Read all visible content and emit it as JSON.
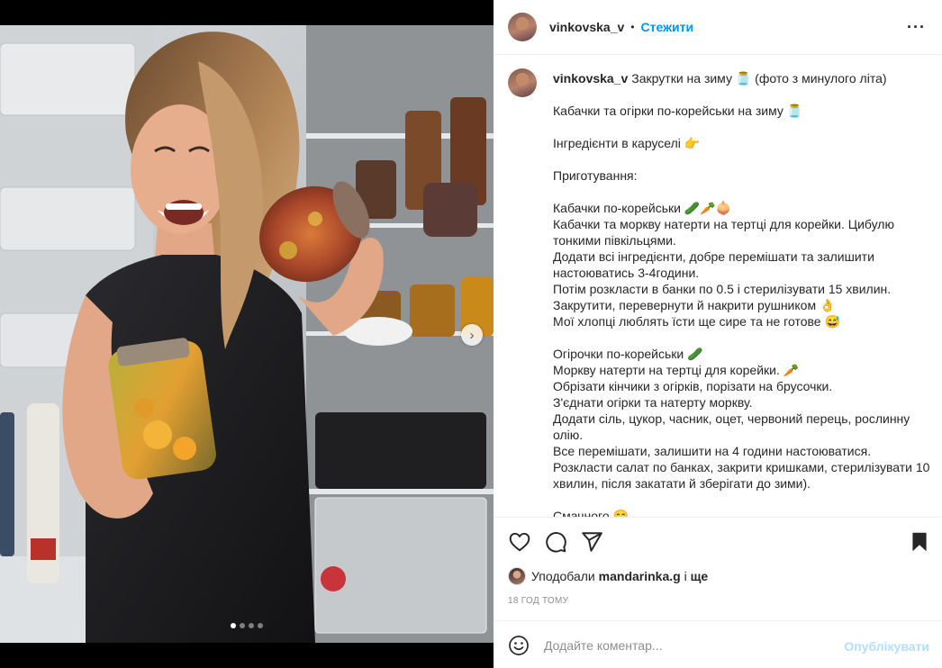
{
  "header": {
    "username": "vinkovska_v",
    "separator": "•",
    "follow_label": "Стежити",
    "more_label": "···"
  },
  "caption": {
    "username": "vinkovska_v",
    "first_line": "Закрутки на зиму 🫙 (фото з минулого літа)",
    "lines": [
      "",
      "Кабачки та огірки по-корейськи на зиму 🫙",
      "",
      "Інгредієнти в каруселі 👉",
      "",
      "Приготування:",
      "",
      "Кабачки по-корейськи 🥒🥕🧅",
      "Кабачки та моркву натерти на тертці для корейки. Цибулю тонкими півкільцями.",
      "Додати всі інгредієнти, добре перемішати та залишити настоюватись 3-4години.",
      "Потім розкласти в банки по 0.5 і стерилізувати 15 хвилин.",
      "Закрутити, перевернути й накрити рушником 👌",
      "Мої хлопці люблять їсти ще сире та не готове 😅",
      "",
      "Огірочки по-корейськи 🥒",
      "Моркву натерти на тертці для корейки. 🥕",
      "Обрізати кінчики з огірків, порізати на брусочки.",
      "З'єднати огірки та натерту моркву.",
      "Додати сіль, цукор, часник, оцет, червоний перець, рослинну олію.",
      "Все перемішати, залишити на 4 години настоюватися.",
      "Розкласти салат по банках, закрити кришками, стерилізувати 10 хвилин, після закатати й зберігати до зими).",
      "",
      "Смачного 😋"
    ]
  },
  "actions": {
    "like_icon": "heart-icon",
    "comment_icon": "comment-icon",
    "share_icon": "paper-plane-icon",
    "save_icon": "bookmark-icon"
  },
  "likes": {
    "prefix": "Уподобали",
    "user": "mandarinka.g",
    "conjunction": "і",
    "others": "ще"
  },
  "timestamp": "18 ГОД ТОМУ",
  "comment": {
    "placeholder": "Додайте коментар...",
    "publish_label": "Опублікувати"
  },
  "carousel": {
    "total": 4,
    "active": 1
  },
  "colors": {
    "accent": "#0095f6",
    "publish_disabled": "#b2dffc",
    "muted": "#8e8e8e"
  }
}
